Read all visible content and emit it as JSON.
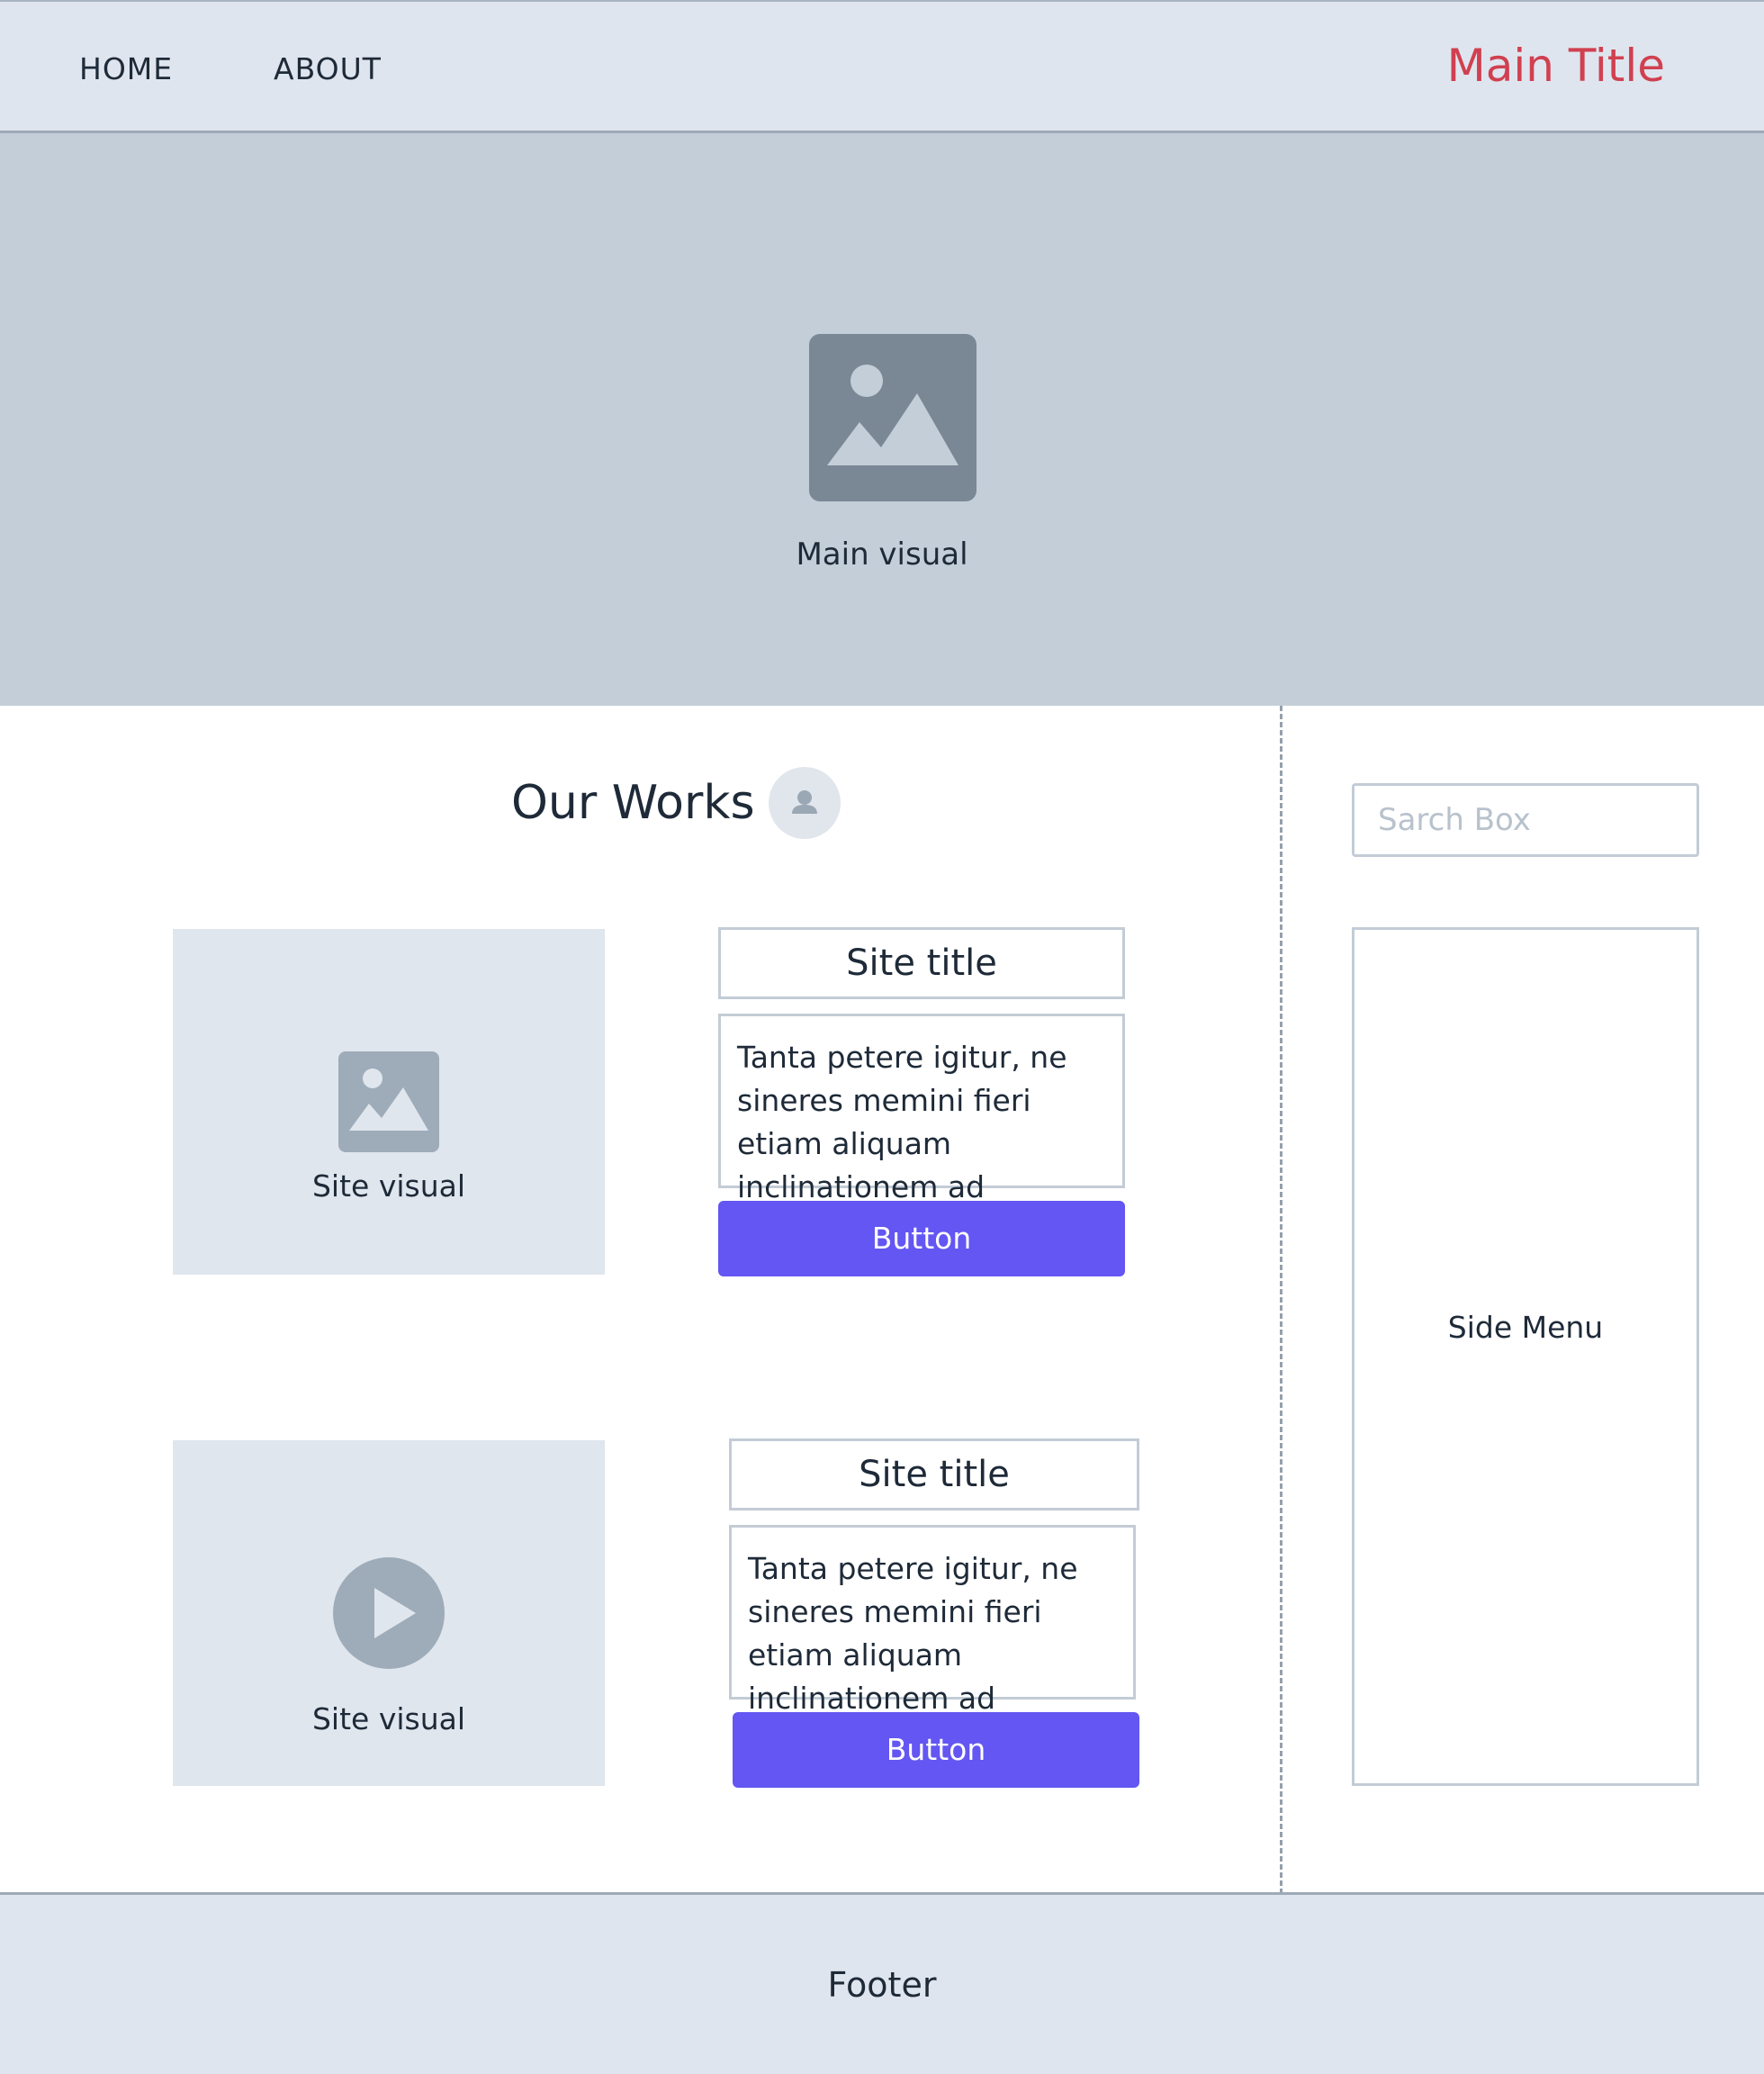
{
  "header": {
    "nav": [
      {
        "label": "HOME"
      },
      {
        "label": "ABOUT"
      }
    ],
    "title": "Main Title",
    "title_color": "#d04050"
  },
  "hero": {
    "icon": "image-icon",
    "label": "Main visual"
  },
  "works": {
    "title": "Our Works",
    "avatar_icon": "user-icon",
    "cards": [
      {
        "visual_icon": "image-icon",
        "visual_label": "Site visual",
        "title": "Site title",
        "description": "Tanta petere igitur, ne sineres memini fieri etiam aliquam inclinationem ad",
        "button_label": "Button"
      },
      {
        "visual_icon": "play-icon",
        "visual_label": "Site visual",
        "title": "Site title",
        "description": "Tanta petere igitur, ne sineres memini fieri etiam aliquam inclinationem ad",
        "button_label": "Button"
      }
    ]
  },
  "sidebar": {
    "search_placeholder": "Sarch Box",
    "menu_label": "Side Menu"
  },
  "footer": {
    "label": "Footer"
  },
  "colors": {
    "accent": "#6356f2",
    "header_bg": "#dfe5ee",
    "hero_bg": "#c3ced8"
  }
}
